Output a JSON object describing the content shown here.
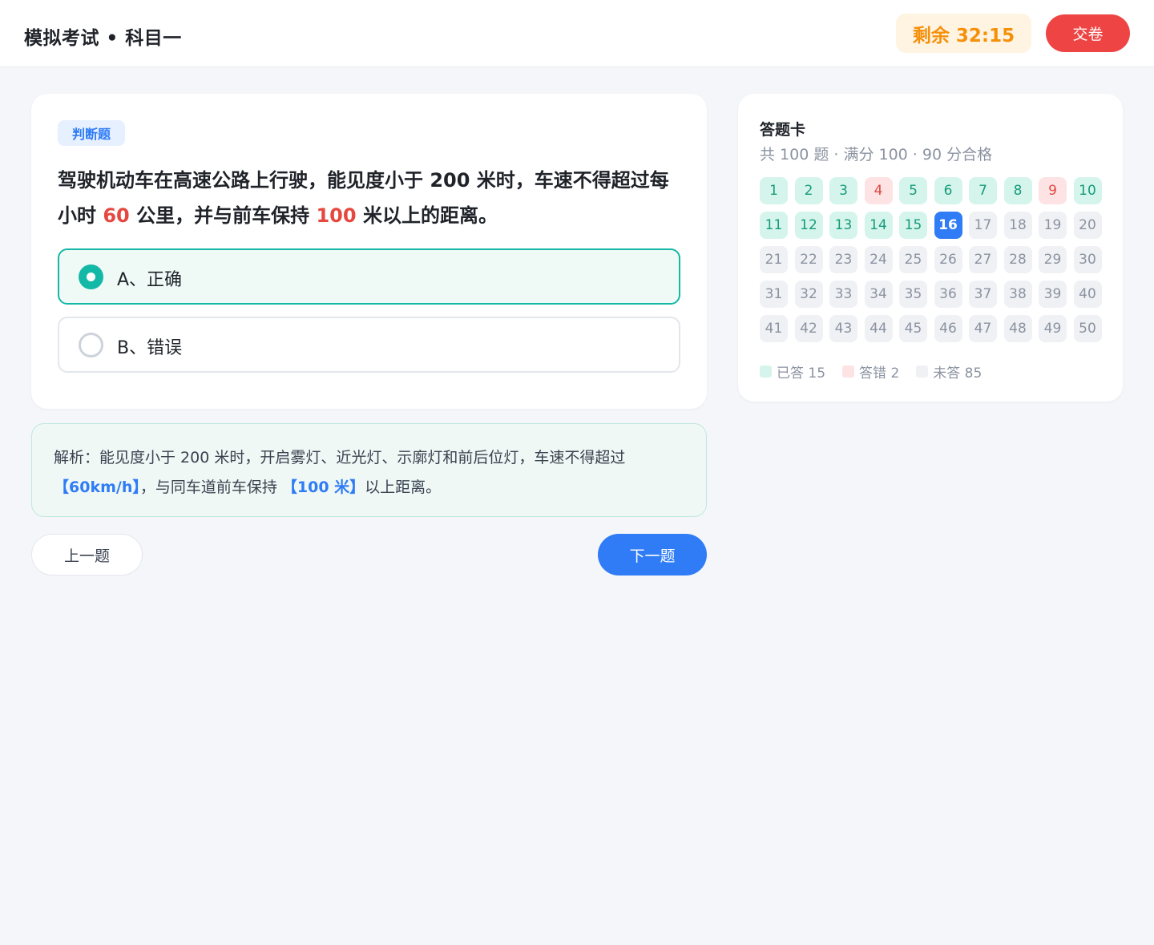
{
  "header": {
    "title": "模拟考试 • 科目一",
    "timer": "剩余 32:15",
    "submit_label": "交卷"
  },
  "question": {
    "type_label": "判断题",
    "stem_parts": [
      "驾驶机动车在高速公路上行驶，能见度小于 200 米时，车速不得超过每小时 ",
      "60",
      " 公里，并与前车保持 ",
      "100",
      " 米以上的距离。"
    ],
    "options": [
      {
        "label": "A、正确",
        "selected": true
      },
      {
        "label": "B、错误",
        "selected": false
      }
    ]
  },
  "analysis": {
    "parts": [
      "解析：能见度小于 200 米时，开启雾灯、近光灯、示廓灯和前后位灯，车速不得超过",
      "【60km/h】",
      "，与同车道前车保持 ",
      "【100 米】",
      "以上距离。"
    ]
  },
  "nav": {
    "prev_label": "上一题",
    "next_label": "下一题"
  },
  "answer_sheet": {
    "title": "答题卡",
    "subtitle": "共 100 题 · 满分 100 · 90 分合格",
    "answered": [
      1,
      2,
      3,
      5,
      6,
      7,
      8,
      10,
      11,
      12,
      13,
      14,
      15
    ],
    "wrong": [
      4,
      9
    ],
    "current": 16,
    "visible_count": 50,
    "legend": [
      {
        "label": "已答 15",
        "status": "answered"
      },
      {
        "label": "答错 2",
        "status": "wrong"
      },
      {
        "label": "未答 85",
        "status": "unanswered"
      }
    ]
  },
  "colors": {
    "accent": "#2f7cf6",
    "answered": "#d5f5ec",
    "wrong": "#fde3e3",
    "selected_border": "#14b8a6",
    "danger": "#ee4444",
    "timer": "#f5900a"
  }
}
